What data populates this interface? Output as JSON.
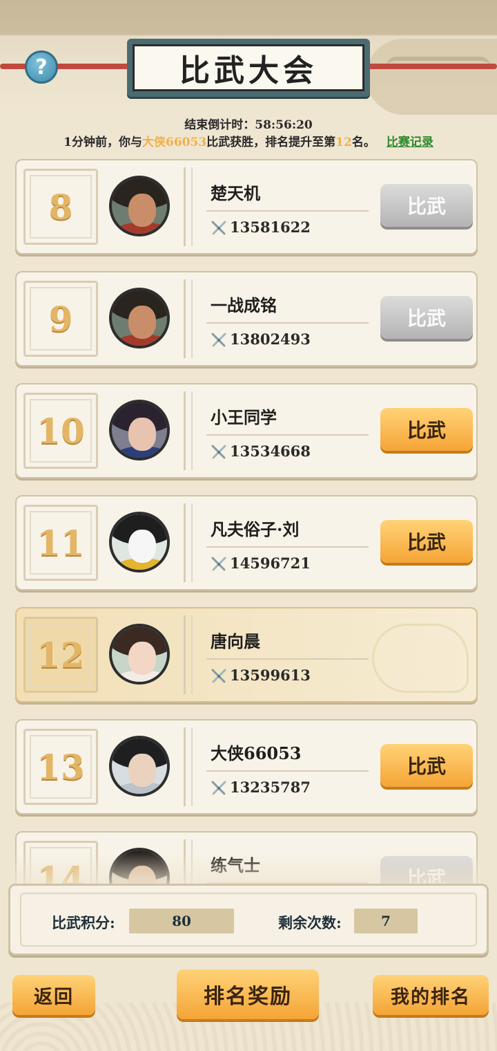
{
  "header": {
    "title": "比武大会",
    "help_symbol": "?"
  },
  "countdown": {
    "label": "结束倒计时：",
    "value": "58:56:20"
  },
  "notice": {
    "prefix": "1分钟前，你与",
    "opponent": "大侠66053",
    "middle": "比武获胜，排名提升至第",
    "rank": "12",
    "suffix": "名。",
    "record_link": "比赛记录"
  },
  "ranking": [
    {
      "rank": "8",
      "name": "楚天机",
      "power": "13581622",
      "button": "比武",
      "enabled": false,
      "mine": false,
      "avatar": "warrior-red-headband"
    },
    {
      "rank": "9",
      "name": "一战成铭",
      "power": "13802493",
      "button": "比武",
      "enabled": false,
      "mine": false,
      "avatar": "warrior-red-headband"
    },
    {
      "rank": "10",
      "name": "小王同学",
      "power": "13534668",
      "button": "比武",
      "enabled": true,
      "mine": false,
      "avatar": "swordswoman"
    },
    {
      "rank": "11",
      "name": "凡夫俗子·刘",
      "power": "14596721",
      "button": "比武",
      "enabled": true,
      "mine": false,
      "avatar": "panda"
    },
    {
      "rank": "12",
      "name": "唐向晨",
      "power": "13599613",
      "button": "",
      "enabled": false,
      "mine": true,
      "avatar": "girl-hair-buns"
    },
    {
      "rank": "13",
      "name": "大侠66053",
      "power": "13235787",
      "button": "比武",
      "enabled": true,
      "mine": false,
      "avatar": "long-haired-swordsman"
    },
    {
      "rank": "14",
      "name": "练气士",
      "power": "",
      "button": "比武",
      "enabled": false,
      "mine": false,
      "avatar": "scholar"
    }
  ],
  "stats": {
    "points_label": "比武积分:",
    "points_value": "80",
    "remaining_label": "剩余次数:",
    "remaining_value": "7"
  },
  "footer": {
    "back": "返回",
    "rewards": "排名奖励",
    "my_rank": "我的排名"
  },
  "colors": {
    "highlight": "#f0b04c",
    "link": "#2f8a2c",
    "button_active": "#f5a536",
    "button_disabled": "#b4b4b4"
  }
}
